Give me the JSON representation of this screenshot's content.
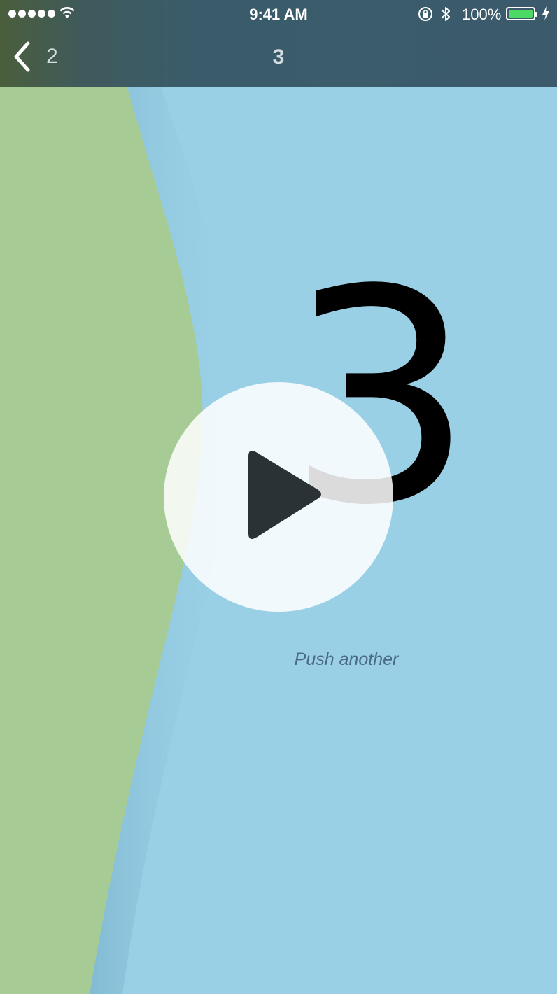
{
  "status_bar": {
    "time": "9:41 AM",
    "battery_percent": "100%",
    "battery_level": 1.0,
    "signal_bars": 5,
    "icons": [
      "signal-dots-icon",
      "wifi-icon",
      "rotation-lock-icon",
      "bluetooth-icon",
      "battery-icon",
      "charging-bolt-icon"
    ]
  },
  "nav_bar": {
    "back_label": "2",
    "title": "3"
  },
  "content": {
    "big_number": "3",
    "caption": "Push another"
  },
  "overlay": {
    "play_icon": "play-icon"
  },
  "colors": {
    "nav_background": "#3b5b6c",
    "left_panel": "#a6cb94",
    "main_panel": "#9ad0e6",
    "battery_fill": "#4cd964",
    "caption_text": "#4a6a86",
    "play_triangle": "#2b3235"
  }
}
